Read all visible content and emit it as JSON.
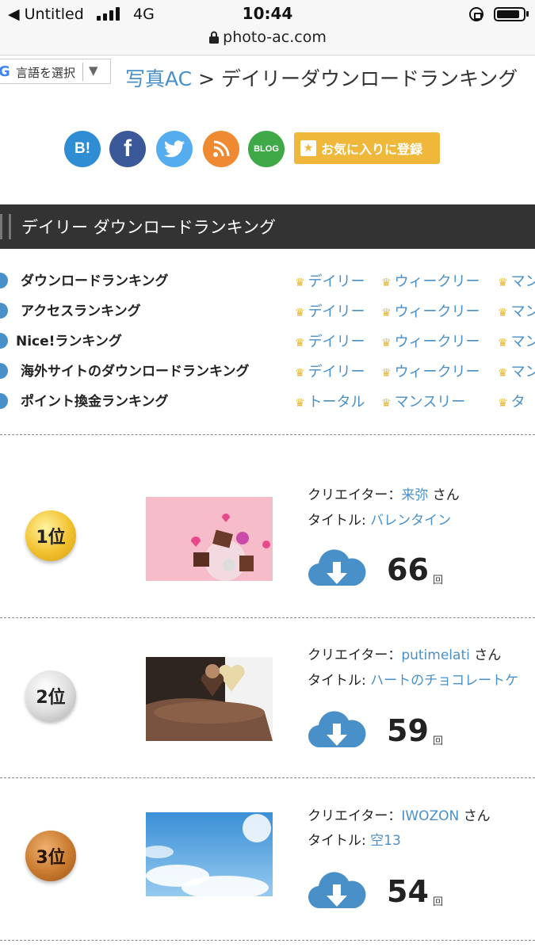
{
  "status_bar": {
    "carrier": "◀ Untitled",
    "network": "4G",
    "time": "10:44",
    "url": "photo-ac.com"
  },
  "translate": {
    "label": "言語を選択",
    "arrow": "▼"
  },
  "breadcrumb": {
    "home": "写真AC",
    "sep": ">",
    "current": "デイリーダウンロードランキング"
  },
  "social": {
    "hatena": "B!",
    "facebook": "f",
    "blog": "BLOG",
    "favorite": "お気に入りに登録"
  },
  "section_title": "デイリー ダウンロードランキング",
  "nav": [
    {
      "name": "ダウンロードランキング",
      "links": [
        "デイリー",
        "ウィークリー",
        "マン"
      ]
    },
    {
      "name": "アクセスランキング",
      "links": [
        "デイリー",
        "ウィークリー",
        "マン"
      ]
    },
    {
      "name": "Nice!ランキング",
      "links": [
        "デイリー",
        "ウィークリー",
        "マン"
      ]
    },
    {
      "name": "海外サイトのダウンロードランキング",
      "links": [
        "デイリー",
        "ウィークリー",
        "マン"
      ]
    },
    {
      "name": "ポイント換金ランキング",
      "links": [
        "トータル",
        "マンスリー",
        "タ"
      ]
    }
  ],
  "labels": {
    "creator": "クリエイター：",
    "title": "タイトル:",
    "san": "さん",
    "kai": "回"
  },
  "ranking": [
    {
      "rank": "1位",
      "creator": "来弥",
      "title": "バレンタイン",
      "count": "66"
    },
    {
      "rank": "2位",
      "creator": "putimelati",
      "title": "ハートのチョコレートケ",
      "count": "59"
    },
    {
      "rank": "3位",
      "creator": "IWOZON",
      "title": "空13",
      "count": "54"
    }
  ],
  "colors": {
    "link": "#4a90c8",
    "header_bg": "#333333",
    "crown": "#e6b83a",
    "fav": "#f0b83a"
  }
}
